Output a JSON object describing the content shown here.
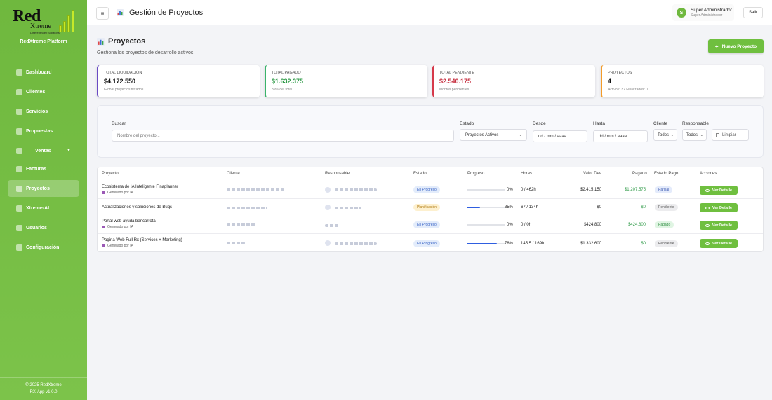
{
  "sidebar": {
    "logo_main": "Red",
    "logo_sub": "Xtreme",
    "logo_tag": "Different Web Solutions",
    "platform": "RedXtreme Platform",
    "items": [
      {
        "label": "Dashboard",
        "icon": "chart-icon"
      },
      {
        "label": "Clientes",
        "icon": "users-icon"
      },
      {
        "label": "Servicios",
        "icon": "gear-icon"
      },
      {
        "label": "Propuestas",
        "icon": "document-icon"
      },
      {
        "label": "Ventas",
        "icon": "sales-icon"
      },
      {
        "label": "Facturas",
        "icon": "money-icon"
      },
      {
        "label": "Proyectos",
        "icon": "chart-icon"
      },
      {
        "label": "Xtreme-AI",
        "icon": "sparkle-icon"
      },
      {
        "label": "Usuarios",
        "icon": "user-icon"
      },
      {
        "label": "Configuración",
        "icon": "gear-icon"
      }
    ],
    "copyright": "© 2025 RedXtreme",
    "version": "RX-App v1.0.0"
  },
  "header": {
    "menu_glyph": "≡",
    "title": "Gestión de Proyectos",
    "user_initial": "S",
    "user_name": "Super Administrador",
    "user_role": "Super Administrador",
    "logout": "Salir"
  },
  "page": {
    "title": "Proyectos",
    "subtitle": "Gestiona los proyectos de desarrollo activos",
    "new_button": "Nuevo Proyecto"
  },
  "stats": [
    {
      "label": "TOTAL LIQUIDACIÓN",
      "value": "$4.172.550",
      "hint": "Global proyectos filtrados",
      "color": "#6a4bc4",
      "value_color": "#111111"
    },
    {
      "label": "TOTAL PAGADO",
      "value": "$1.632.375",
      "hint": "39% del total",
      "color": "#3bb36b",
      "value_color": "#2e9a47"
    },
    {
      "label": "TOTAL PENDIENTE",
      "value": "$2.540.175",
      "hint": "Montos pendientes",
      "color": "#d6394a",
      "value_color": "#c62f3f"
    },
    {
      "label": "PROYECTOS",
      "value": "4",
      "hint": "Activos: 3 • Finalizados: 0",
      "color": "#f39c2a",
      "value_color": "#111111"
    }
  ],
  "filters": {
    "search_label": "Buscar",
    "search_placeholder": "Nombre del proyecto...",
    "estado_label": "Estado",
    "estado_value": "Proyectos Activos",
    "desde_label": "Desde",
    "desde_value": "dd / mm / aaaa",
    "hasta_label": "Hasta",
    "hasta_value": "dd / mm / aaaa",
    "cliente_label": "Cliente",
    "cliente_value": "Todos",
    "responsable_label": "Responsable",
    "responsable_value": "Todos",
    "clear": "Limpiar"
  },
  "table": {
    "headers": [
      "Proyecto",
      "Cliente",
      "Responsable",
      "Estado",
      "Progreso",
      "Horas",
      "Valor Dev.",
      "Pagado",
      "Estado Pago",
      "Acciones"
    ],
    "action_label": "Ver Detalle",
    "rows": [
      {
        "name": "Ecosistema de IA Inteligente Finaplanner",
        "sub": "Generado por IA",
        "estado": "En Progreso",
        "estado_kind": "prog",
        "progress": 0,
        "progress_label": "0%",
        "horas": "0 / 462h",
        "valor": "$2.415.150",
        "pagado": "$1.207.575",
        "pago": "Parcial",
        "pago_kind": "par"
      },
      {
        "name": "Actualizaciones y soluciones de Bugs",
        "sub": "",
        "estado": "Planificación",
        "estado_kind": "plan",
        "progress": 35,
        "progress_label": "35%",
        "horas": "67 / 134h",
        "valor": "$0",
        "pagado": "$0",
        "pago": "Pendiente",
        "pago_kind": "pend"
      },
      {
        "name": "Portal web ayuda bancarrota",
        "sub": "Generado por IA",
        "estado": "En Progreso",
        "estado_kind": "prog",
        "progress": 0,
        "progress_label": "0%",
        "horas": "0 / 0h",
        "valor": "$424.800",
        "pagado": "$424.800",
        "pago": "Pagado",
        "pago_kind": "pay"
      },
      {
        "name": "Pagina Web Full Rx (Services + Marketing)",
        "sub": "Generado por IA",
        "estado": "En Progreso",
        "estado_kind": "prog",
        "progress": 78,
        "progress_label": "78%",
        "horas": "145.5 / 169h",
        "valor": "$1.332.600",
        "pagado": "$0",
        "pago": "Pendiente",
        "pago_kind": "pend"
      }
    ]
  }
}
